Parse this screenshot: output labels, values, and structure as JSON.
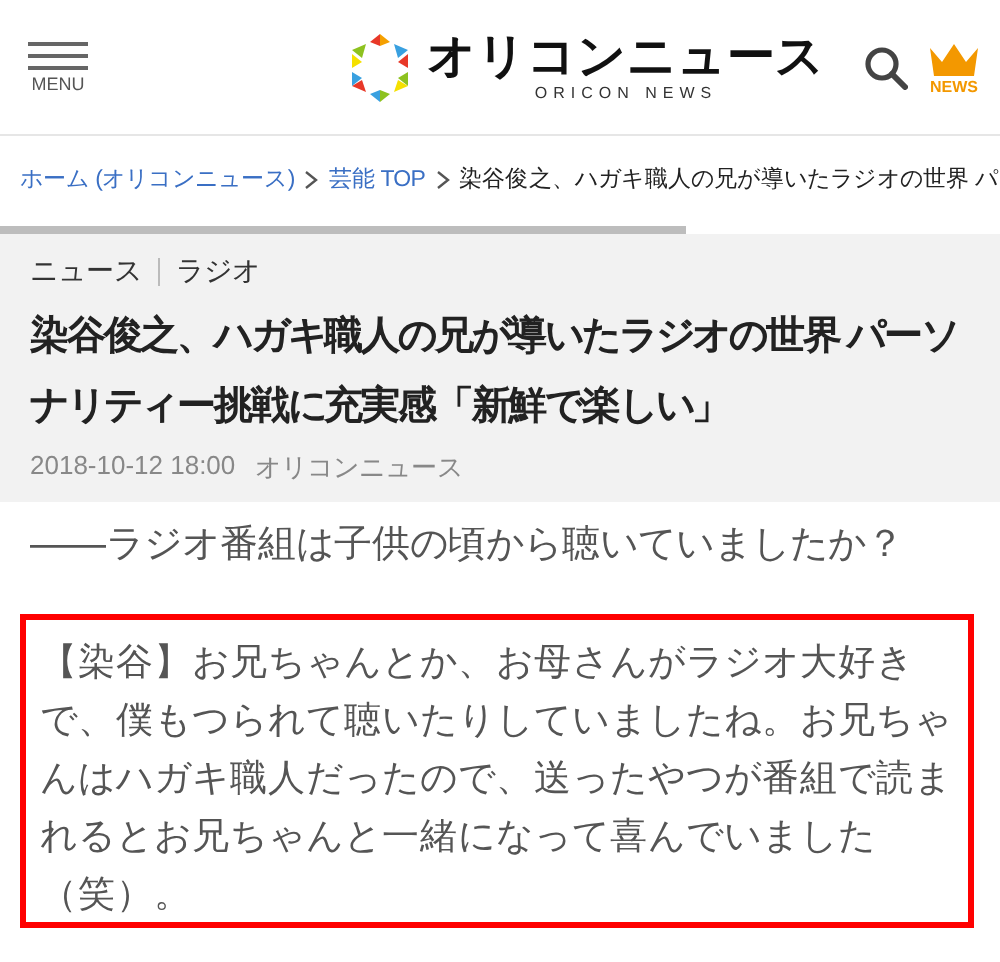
{
  "header": {
    "menu_label": "MENU",
    "logo_text": "オリコンニュース",
    "logo_subtext": "ORICON NEWS",
    "news_label": "NEWS"
  },
  "breadcrumbs": [
    {
      "label": "ホーム (オリコンニュース)",
      "kind": "link"
    },
    {
      "label": "芸能 TOP",
      "kind": "link"
    },
    {
      "label": "染谷俊之、ハガキ職人の兄が導いたラジオの世界 パ",
      "kind": "current"
    }
  ],
  "reading_progress": {
    "level": 0.686
  },
  "article": {
    "categories": [
      "ニュース",
      "ラジオ"
    ],
    "title": "染谷俊之、ハガキ職人の兄が導いたラジオの世界 パーソナリティー挑戦に充実感「新鮮で楽しい」",
    "date": "2018-10-12 18:00",
    "source": "オリコンニュース"
  },
  "body": [
    {
      "kind": "question",
      "text": "――ラジオ番組は子供の頃から聴いていましたか？"
    },
    {
      "kind": "highlighted",
      "text": "【染谷】お兄ちゃんとか、お母さんがラジオ大好きで、僕もつられて聴いたりしていましたね。お兄ちゃんはハガキ職人だったので、送ったやつが番組で読まれるとお兄ちゃんと一緒になって喜んでいました（笑）。"
    }
  ]
}
